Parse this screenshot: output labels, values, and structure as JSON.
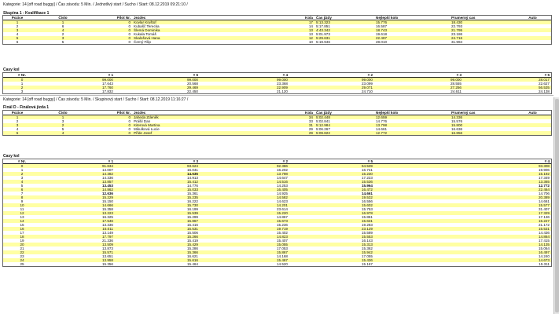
{
  "race1": {
    "category_line": "Kategorie: 14 [off road buggy] / Čas závodu: 5 Min. / Jednotlivý start / Sucho / Start: 08.12.2019 09:21:10 /",
    "group_line": "Skupina 1 - Kvalifikace 1",
    "results_headers": [
      "Pozice",
      "Číslo",
      "Pilot Nr.",
      "Jezdec",
      "Kola",
      "Čas jízdy",
      "Nejlepší kolo",
      "Prumerný cas",
      "Auto"
    ],
    "results_rows": [
      [
        "1",
        "1",
        "0",
        "Kovlar Kryštof",
        "17",
        "5:13.323",
        "15.776",
        "18.430",
        ""
      ],
      [
        "2",
        "6",
        "0",
        "Kubašč Terecka",
        "14",
        "5:17.851",
        "16.587",
        "22.793",
        ""
      ],
      [
        "3",
        "4",
        "0",
        "Šlemá Dominika",
        "13",
        "4:43.342",
        "18.743",
        "21.795",
        ""
      ],
      [
        "4",
        "2",
        "0",
        "Kukala Tomáš",
        "13",
        "5:01.973",
        "19.618",
        "23.186",
        ""
      ],
      [
        "5",
        "3",
        "0",
        "Skalošová Hana",
        "12",
        "5:29.631",
        "22.487",
        "24.716",
        ""
      ],
      [
        "6",
        "5",
        "0",
        "Černý Filip",
        "10",
        "5:19.946",
        "28.010",
        "31.994",
        ""
      ]
    ],
    "laps_title": "Casy kol",
    "laps_headers": [
      "# Nr.",
      "# 1",
      "# 6",
      "# 4",
      "# 2",
      "# 3",
      "# 5"
    ],
    "laps_rows": [
      [
        "0",
        "99.000",
        "99.000",
        "99.000",
        "99.000",
        "99.000",
        "28.017"
      ],
      [
        "1",
        "17.643",
        "20.568",
        "23.368",
        "23.099",
        "28.555",
        "22.627"
      ],
      [
        "2",
        "17.760",
        "29.469",
        "22.909",
        "29.071",
        "27.256",
        "56.535"
      ],
      [
        "3",
        "17.832",
        "22.450",
        "21.120",
        "24.710",
        "24.611",
        "24.138"
      ]
    ]
  },
  "race2": {
    "category_line": "Kategorie: 14 [off road buggy] / Čas závodu: 5 Min. / Skupinový start / Sucho / Start: 08.12.2019 11:16:27 /",
    "group_line": "Finál D - Finálová jízda 1",
    "results_headers": [
      "Pozice",
      "Číslo",
      "Pilot Nr.",
      "Jezdec",
      "Kola",
      "Čas jízdy",
      "Nejlepší kolo",
      "Prumerný cas",
      "Auto"
    ],
    "results_rows": [
      [
        "1",
        "1",
        "0",
        "Jaheda Zdeněk",
        "34",
        "5:02.448",
        "12.659",
        "14.336",
        ""
      ],
      [
        "2",
        "3",
        "0",
        "Prášil Dan",
        "33",
        "5:02.841",
        "14.776",
        "15.576",
        ""
      ],
      [
        "3",
        "2",
        "0",
        "Kiterová Martina",
        "31",
        "5:12.984",
        "13.798",
        "15.800",
        ""
      ],
      [
        "4",
        "5",
        "0",
        "Mikulková Lucie",
        "29",
        "5:06.267",
        "14.661",
        "16.636",
        ""
      ],
      [
        "5",
        "4",
        "0",
        "Příde Josef",
        "29",
        "5:09.822",
        "12.772",
        "16.856",
        ""
      ]
    ],
    "laps_title": "Casy kol",
    "laps_headers": [
      "# Nr.",
      "# 1",
      "# 3",
      "# 2",
      "# 5",
      "# 4"
    ],
    "laps_rows": [
      [
        "0",
        "91.634",
        "93.624",
        "92.386",
        "64.539",
        "93.308"
      ],
      [
        "1",
        "14.007",
        "16.041",
        "16.202",
        "16.741",
        "19.906"
      ],
      [
        "2",
        "14.382",
        "14.635",
        "13.798",
        "15.230",
        "15.192"
      ],
      [
        "3",
        "14.336",
        "14.913",
        "14.647",
        "17.223",
        "17.349"
      ],
      [
        "4",
        "13.857",
        "15.412",
        "14.516",
        "15.536",
        "13.365"
      ],
      [
        "5",
        "13.453",
        "14.776",
        "14.253",
        "15.964",
        "12.772"
      ],
      [
        "6",
        "14.862",
        "15.033",
        "16.405",
        "16.472",
        "22.464"
      ],
      [
        "7",
        "12.636",
        "15.361",
        "14.925",
        "14.661",
        "14.706"
      ],
      [
        "8",
        "15.229",
        "15.235",
        "14.582",
        "19.532",
        "20.389"
      ],
      [
        "9",
        "15.150",
        "16.222",
        "14.623",
        "16.556",
        "14.661"
      ],
      [
        "10",
        "14.666",
        "15.730",
        "14.201",
        "15.602",
        "15.577"
      ],
      [
        "11",
        "15.358",
        "16.199",
        "23.614",
        "15.753",
        "31.407"
      ],
      [
        "12",
        "13.223",
        "15.539",
        "15.220",
        "16.978",
        "17.329"
      ],
      [
        "13",
        "16.325",
        "15.299",
        "14.867",
        "15.861",
        "17.136"
      ],
      [
        "14",
        "17.546",
        "15.867",
        "15.673",
        "15.631",
        "15.227"
      ],
      [
        "15",
        "13.336",
        "15.416",
        "15.236",
        "19.283",
        "21.172"
      ],
      [
        "16",
        "15.011",
        "15.531",
        "19.719",
        "23.129",
        "15.531"
      ],
      [
        "17",
        "13.149",
        "15.506",
        "15.402",
        "15.589",
        "14.436"
      ],
      [
        "18",
        "17.797",
        "15.266",
        "14.823",
        "15.553",
        "14.864"
      ],
      [
        "19",
        "21.336",
        "15.419",
        "15.407",
        "16.143",
        "17.415"
      ],
      [
        "20",
        "13.509",
        "15.429",
        "15.055",
        "15.313",
        "14.135"
      ],
      [
        "21",
        "13.873",
        "15.286",
        "17.053",
        "15.362",
        "15.064"
      ],
      [
        "22",
        "15.571",
        "15.366",
        "15.867",
        "15.942",
        "16.497"
      ],
      [
        "23",
        "13.651",
        "16.621",
        "14.168",
        "17.055",
        "14.240"
      ],
      [
        "24",
        "13.958",
        "15.616",
        "15.467",
        "15.436",
        "14.673"
      ],
      [
        "25",
        "15.356",
        "15.464",
        "14.520",
        "15.167",
        "15.311"
      ]
    ]
  },
  "bold_cells": [
    "2.2",
    "5.1",
    "5.4",
    "5.5",
    "7.1",
    "7.4"
  ]
}
